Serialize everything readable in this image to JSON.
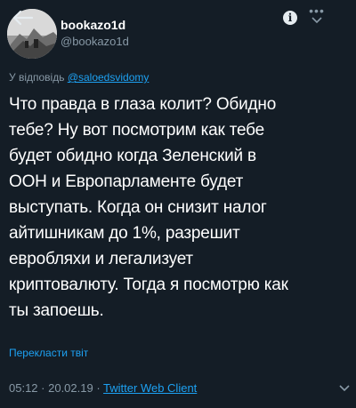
{
  "header": {
    "username": "bookazo1d",
    "handle": "@bookazo1d"
  },
  "tweet": {
    "reply_prefix": "У відповідь ",
    "reply_mention": "@saloedsvidomy",
    "text": "Что правда в глаза колит? Обидно\nтебе? Ну вот посмотрим как тебе\nбудет обидно когда Зеленский в\nООН и Европарламенте будет\nвыступать. Когда он снизит налог\nайтишникам до 1%, разрешит\nевробляхи и легализует\nкриптовалюту. Тогда я посмотрю как\nты запоешь.",
    "translate_label": "Перекласти твіт",
    "time": "05:12",
    "separator": " · ",
    "date": "20.02.19",
    "client": "Twitter Web Client"
  },
  "icons": {
    "back": "arrow-left-icon",
    "info": "info-icon",
    "more": "more-icon",
    "chevron": "chevron-down-icon"
  },
  "colors": {
    "background": "#141d26",
    "link": "#1da1f2",
    "muted": "#8899a6",
    "text": "#ffffff"
  }
}
